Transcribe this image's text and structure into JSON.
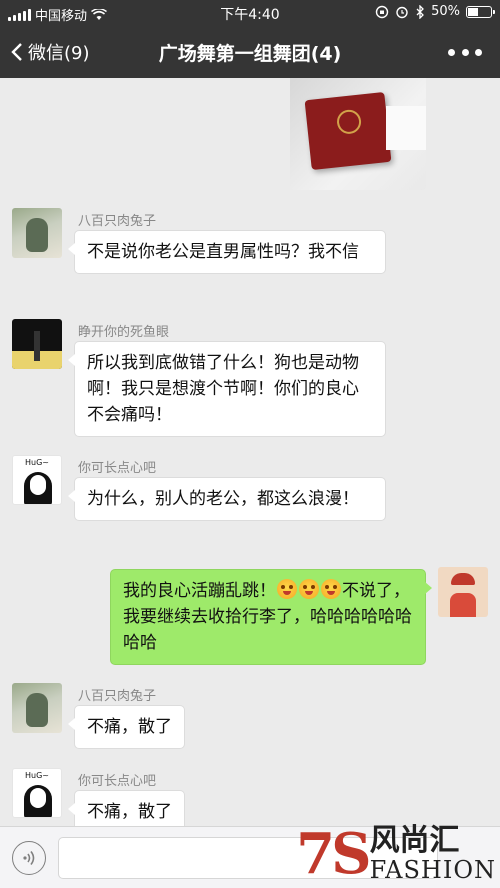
{
  "status": {
    "carrier": "中国移动",
    "time": "下午4:40",
    "battery": "50%",
    "battery_level": 0.5
  },
  "nav": {
    "back_label": "微信(9)",
    "title": "广场舞第一组舞团(4)"
  },
  "messages": [
    {
      "sender": "八百只肉兔子",
      "text": "不是说你老公是直男属性吗？我不信"
    },
    {
      "sender": "睁开你的死鱼眼",
      "text": "所以我到底做错了什么！狗也是动物啊！我只是想渡个节啊！你们的良心不会痛吗！"
    },
    {
      "sender": "你可长点心吧",
      "text": "为什么，别人的老公，都这么浪漫！"
    },
    {
      "sender": "me",
      "text_before": "我的良心活蹦乱跳！",
      "text_after": "不说了，我要继续去收拾行李了，哈哈哈哈哈哈哈哈"
    },
    {
      "sender": "八百只肉兔子",
      "text": "不痛，散了"
    },
    {
      "sender": "你可长点心吧",
      "text": "不痛，散了"
    }
  ],
  "watermark": {
    "num": "7S",
    "cn": "风尚汇",
    "en": "FASHION"
  },
  "avatars": {
    "noface_text": "HuG~"
  },
  "colors": {
    "nav_bg": "#353535",
    "chat_bg": "#ebebeb",
    "bubble_me": "#9eea6a"
  }
}
